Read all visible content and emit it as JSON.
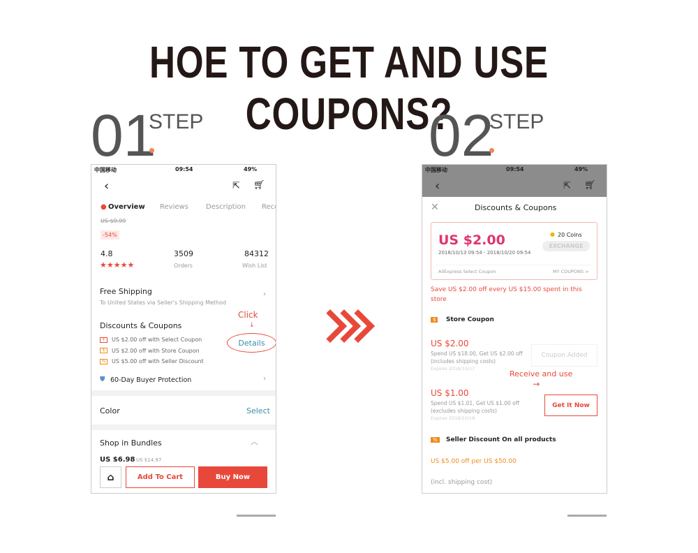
{
  "title": "HOE TO GET AND USE COUPONS?",
  "steps": [
    {
      "number": "01",
      "label": "STEP"
    },
    {
      "number": "02",
      "label": "STEP"
    }
  ],
  "status": {
    "carrier": "中国移动",
    "time": "09:54",
    "battery": "49%"
  },
  "phone1": {
    "tabs": [
      "Overview",
      "Reviews",
      "Description",
      "Reco"
    ],
    "old_price": "US $9.99",
    "discount": "-54%",
    "rating": "4.8",
    "orders": "3509",
    "orders_label": "Orders",
    "wishlist": "84312",
    "wishlist_label": "Wish List",
    "shipping_title": "Free Shipping",
    "shipping_sub": "To United States via Seller's Shipping Method",
    "discounts_title": "Discounts & Coupons",
    "coupons": [
      "US $2.00 off with Select Coupon",
      "US $2.00 off with Store Coupon",
      "US $5.00 off with Seller Discount"
    ],
    "click_annotation": "Click",
    "details": "Details",
    "protection": "60-Day Buyer Protection",
    "color_label": "Color",
    "color_select": "Select",
    "bundles": "Shop in Bundles",
    "bundle_price": "US $6.98",
    "bundle_old": "US $14.97",
    "add_to_cart": "Add To Cart",
    "buy_now": "Buy Now"
  },
  "phone2": {
    "header": "Discounts & Coupons",
    "coupon_value": "US $2.00",
    "coins": "20 Coins",
    "exchange": "EXCHANGE",
    "validity": "2018/10/13 09:54 - 2018/10/20 09:54",
    "coupon_type": "AliExpress Select Coupon",
    "my_coupons": "MY COUPONS >",
    "save_text": "Save US $2.00 off every US $15.00 spent in this store",
    "store_coupon_title": "Store Coupon",
    "store_coupons": [
      {
        "value": "US $2.00",
        "desc": "Spend US $18.00, Get US $2.00 off",
        "note": "(includes shipping costs)",
        "expires": "Expires 2018/10/17",
        "action": "Coupon Added"
      },
      {
        "value": "US $1.00",
        "desc": "Spend US $1.01, Get US $1.00 off",
        "note": "(excludes shipping costs)",
        "expires": "Expires 2018/10/18",
        "action": "Get It Now"
      }
    ],
    "annotation": "Receive and use",
    "seller_title": "Seller Discount On all products",
    "seller_offer": "US $5.00 off per US $50.00",
    "seller_note": "(incl. shipping cost)"
  },
  "colors": {
    "accent": "#e8483a",
    "orange": "#f08a1c",
    "pink": "#e0356a",
    "teal": "#3b8ea5"
  }
}
